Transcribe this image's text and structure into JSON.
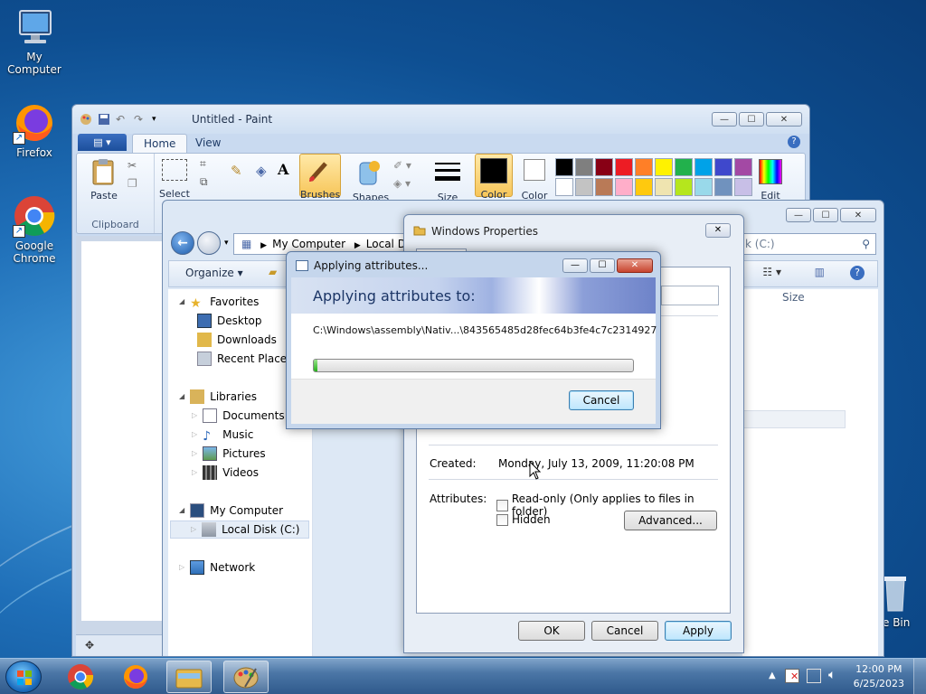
{
  "desktop": {
    "icons": [
      {
        "label": "My Computer"
      },
      {
        "label": "Firefox"
      },
      {
        "label": "Google Chrome"
      },
      {
        "label": "e Bin"
      }
    ]
  },
  "paint": {
    "title": "Untitled - Paint",
    "tabs": [
      "Home",
      "View"
    ],
    "groups": {
      "clipboard": "Clipboard",
      "paste": "Paste",
      "select": "Select",
      "brushes": "Brushes",
      "shapes": "Shapes",
      "size": "Size",
      "color1": "Color",
      "color2": "Color",
      "edit": "Edit"
    },
    "palette": [
      "#000000",
      "#7f7f7f",
      "#880015",
      "#ed1c24",
      "#ff7f27",
      "#fff200",
      "#22b14c",
      "#00a2e8",
      "#3f48cc",
      "#a349a4",
      "#ffffff",
      "#c3c3c3",
      "#b97a57",
      "#ffaec9",
      "#ffc90e",
      "#efe4b0",
      "#b5e61d",
      "#99d9ea",
      "#7092be",
      "#c8bfe7"
    ]
  },
  "explorer": {
    "address": [
      "My Computer",
      "Local Disk"
    ],
    "search_placeholder": "k (C:)",
    "toolbar": {
      "organize": "Organize"
    },
    "column_size": "Size",
    "nav": {
      "favorites": "Favorites",
      "desktop": "Desktop",
      "downloads": "Downloads",
      "recent": "Recent Places",
      "libraries": "Libraries",
      "documents": "Documents",
      "music": "Music",
      "pictures": "Pictures",
      "videos": "Videos",
      "computer": "My Computer",
      "localdisk": "Local Disk (C:)",
      "network": "Network"
    }
  },
  "properties": {
    "title": "Windows Properties",
    "created_label": "Created:",
    "created_value": "Monday, July 13, 2009, 11:20:08 PM",
    "attributes_label": "Attributes:",
    "readonly": "Read-only (Only applies to files in folder)",
    "hidden": "Hidden",
    "advanced": "Advanced...",
    "ok": "OK",
    "cancel": "Cancel",
    "apply": "Apply"
  },
  "progress": {
    "title": "Applying attributes...",
    "heading": "Applying attributes to:",
    "path": "C:\\Windows\\assembly\\Nativ...\\843565485d28fec64b3fe4c7c2314927",
    "percent": 1,
    "cancel": "Cancel"
  },
  "taskbar": {
    "time": "12:00 PM",
    "date": "6/25/2023"
  }
}
